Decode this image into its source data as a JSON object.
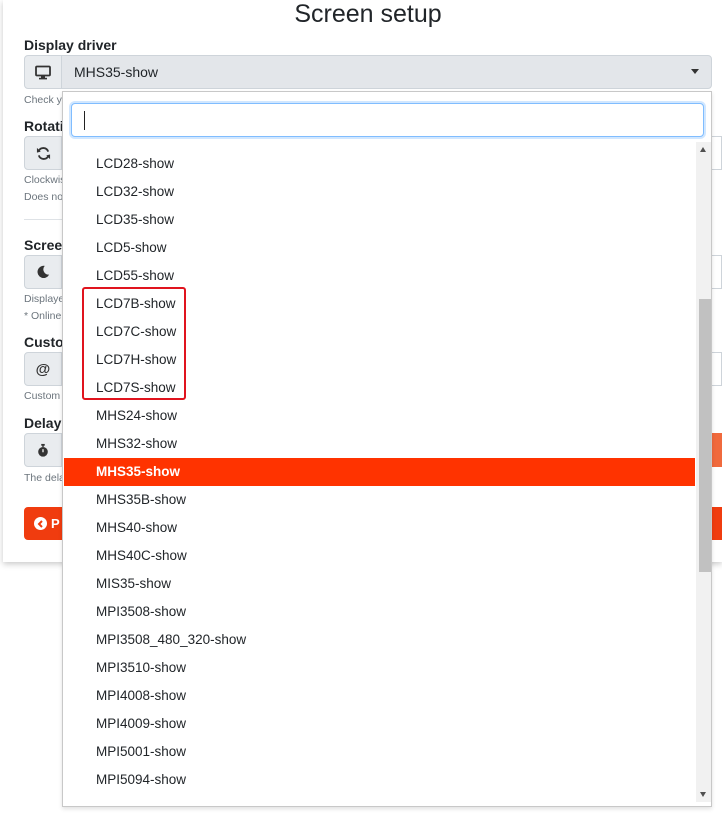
{
  "page": {
    "title": "Screen setup"
  },
  "display_driver": {
    "label": "Display driver",
    "icon": "monitor-icon",
    "selected": "MHS35-show",
    "help_partial": "Check y"
  },
  "rotation": {
    "label_partial": "Rotati",
    "icon": "sync-icon",
    "help_line1_partial": "Clockwis",
    "help_line2_partial": "Does no"
  },
  "screensaver": {
    "label_partial": "Screer",
    "icon": "moon-icon",
    "help_line1_partial": "Displaye",
    "help_line2_partial": "* Online"
  },
  "custom": {
    "label_partial": "Custor",
    "icon": "at-icon",
    "help_partial": "Custom"
  },
  "delay": {
    "label_partial": "Delay",
    "icon": "stopwatch-icon",
    "help_partial": "The dela"
  },
  "back_button": {
    "label_partial": "P",
    "icon": "chevron-left-circle-icon"
  },
  "dropdown": {
    "search_value": "",
    "options": [
      "LCD28-show",
      "LCD32-show",
      "LCD35-show",
      "LCD5-show",
      "LCD55-show",
      "LCD7B-show",
      "LCD7C-show",
      "LCD7H-show",
      "LCD7S-show",
      "MHS24-show",
      "MHS32-show",
      "MHS35-show",
      "MHS35B-show",
      "MHS40-show",
      "MHS40C-show",
      "MIS35-show",
      "MPI3508-show",
      "MPI3508_480_320-show",
      "MPI3510-show",
      "MPI4008-show",
      "MPI4009-show",
      "MPI5001-show",
      "MPI5094-show"
    ],
    "selected_index": 11,
    "highlighted_range": [
      5,
      8
    ]
  },
  "colors": {
    "accent": "#ff3300",
    "highlight_border": "#e0141e",
    "focus_border": "#80bdff"
  }
}
